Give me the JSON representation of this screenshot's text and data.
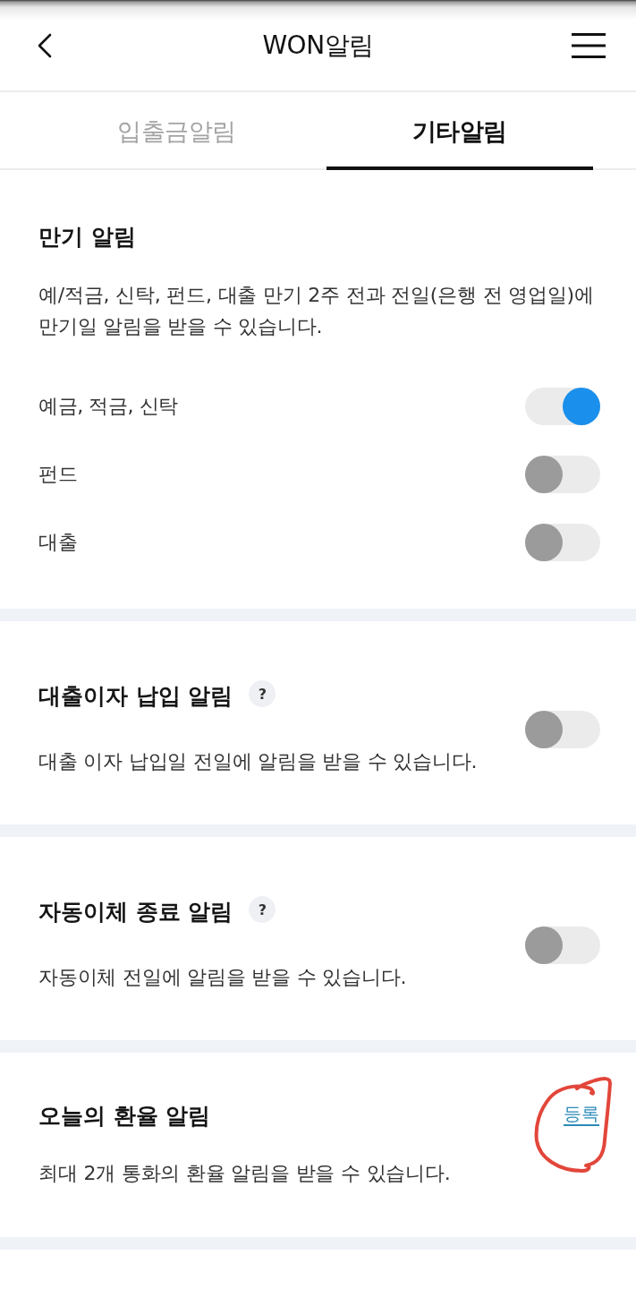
{
  "header": {
    "title": "WON알림"
  },
  "tabs": [
    {
      "label": "입출금알림",
      "selected": false
    },
    {
      "label": "기타알림",
      "selected": true
    }
  ],
  "sections": [
    {
      "kind": "group",
      "title": "만기 알림",
      "description": "예/적금, 신탁, 펀드, 대출 만기 2주 전과 전일(은행 전 영업일)에 만기일 알림을 받을 수 있습니다.",
      "items": [
        {
          "label": "예금, 적금, 신탁",
          "on": true
        },
        {
          "label": "펀드",
          "on": false
        },
        {
          "label": "대출",
          "on": false
        }
      ]
    },
    {
      "kind": "toggle",
      "title": "대출이자 납입 알림",
      "help": "?",
      "description": "대출 이자 납입일 전일에 알림을 받을 수 있습니다.",
      "on": false
    },
    {
      "kind": "toggle",
      "title": "자동이체 종료 알림",
      "help": "?",
      "description": "자동이체 전일에 알림을 받을 수 있습니다.",
      "on": false
    },
    {
      "kind": "link",
      "title": "오늘의 환율 알림",
      "link": "등록",
      "circled": true,
      "description": "최대 2개 통화의 환율 알림을 받을 수 있습니다."
    }
  ]
}
